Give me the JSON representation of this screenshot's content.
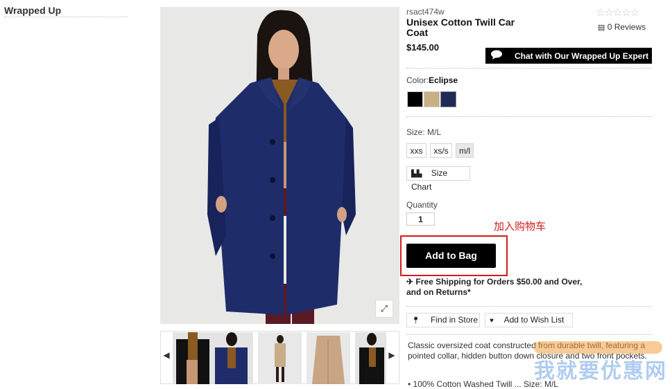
{
  "sidebar": {
    "title": "Wrapped Up"
  },
  "product": {
    "sku": "rsact474w",
    "name": "Unisex Cotton Twill Car Coat",
    "price": "$145.00",
    "rating_stars": "☆☆☆☆☆",
    "reviews_label": "0 Reviews"
  },
  "chat": {
    "label": "Chat with Our Wrapped Up Expert"
  },
  "color": {
    "label": "Color:",
    "selected": "Eclipse",
    "swatches": [
      "#000000",
      "#c8b083",
      "#1f2a55"
    ]
  },
  "size": {
    "label": "Size:",
    "selected": "M/L",
    "options": [
      "xxs",
      "xs/s",
      "m/l"
    ],
    "chart_label": "Size Chart"
  },
  "quantity": {
    "label": "Quantity",
    "value": "1"
  },
  "annotation": {
    "cn_note": "加入购物车"
  },
  "cart": {
    "add_label": "Add to Bag"
  },
  "shipping": {
    "text": "✈ Free Shipping for Orders $50.00 and Over, and on Returns*"
  },
  "actions": {
    "find_store": "Find in Store",
    "wish_list": "Add to Wish List"
  },
  "description": {
    "text": "Classic oversized coat constructed from durable twill, featuring a pointed collar, hidden button down closure and two front pockets.",
    "partial_line": "• 100% Cotton Washed Twill ... Size: M/L"
  },
  "gallery": {
    "expand_icon": "⤢",
    "prev": "◀",
    "next": "▶"
  },
  "watermark": {
    "text": "我就要优惠网"
  },
  "colors": {
    "accent": "#000000",
    "highlight": "#d21b1b",
    "coat": "#1e2c6a"
  }
}
